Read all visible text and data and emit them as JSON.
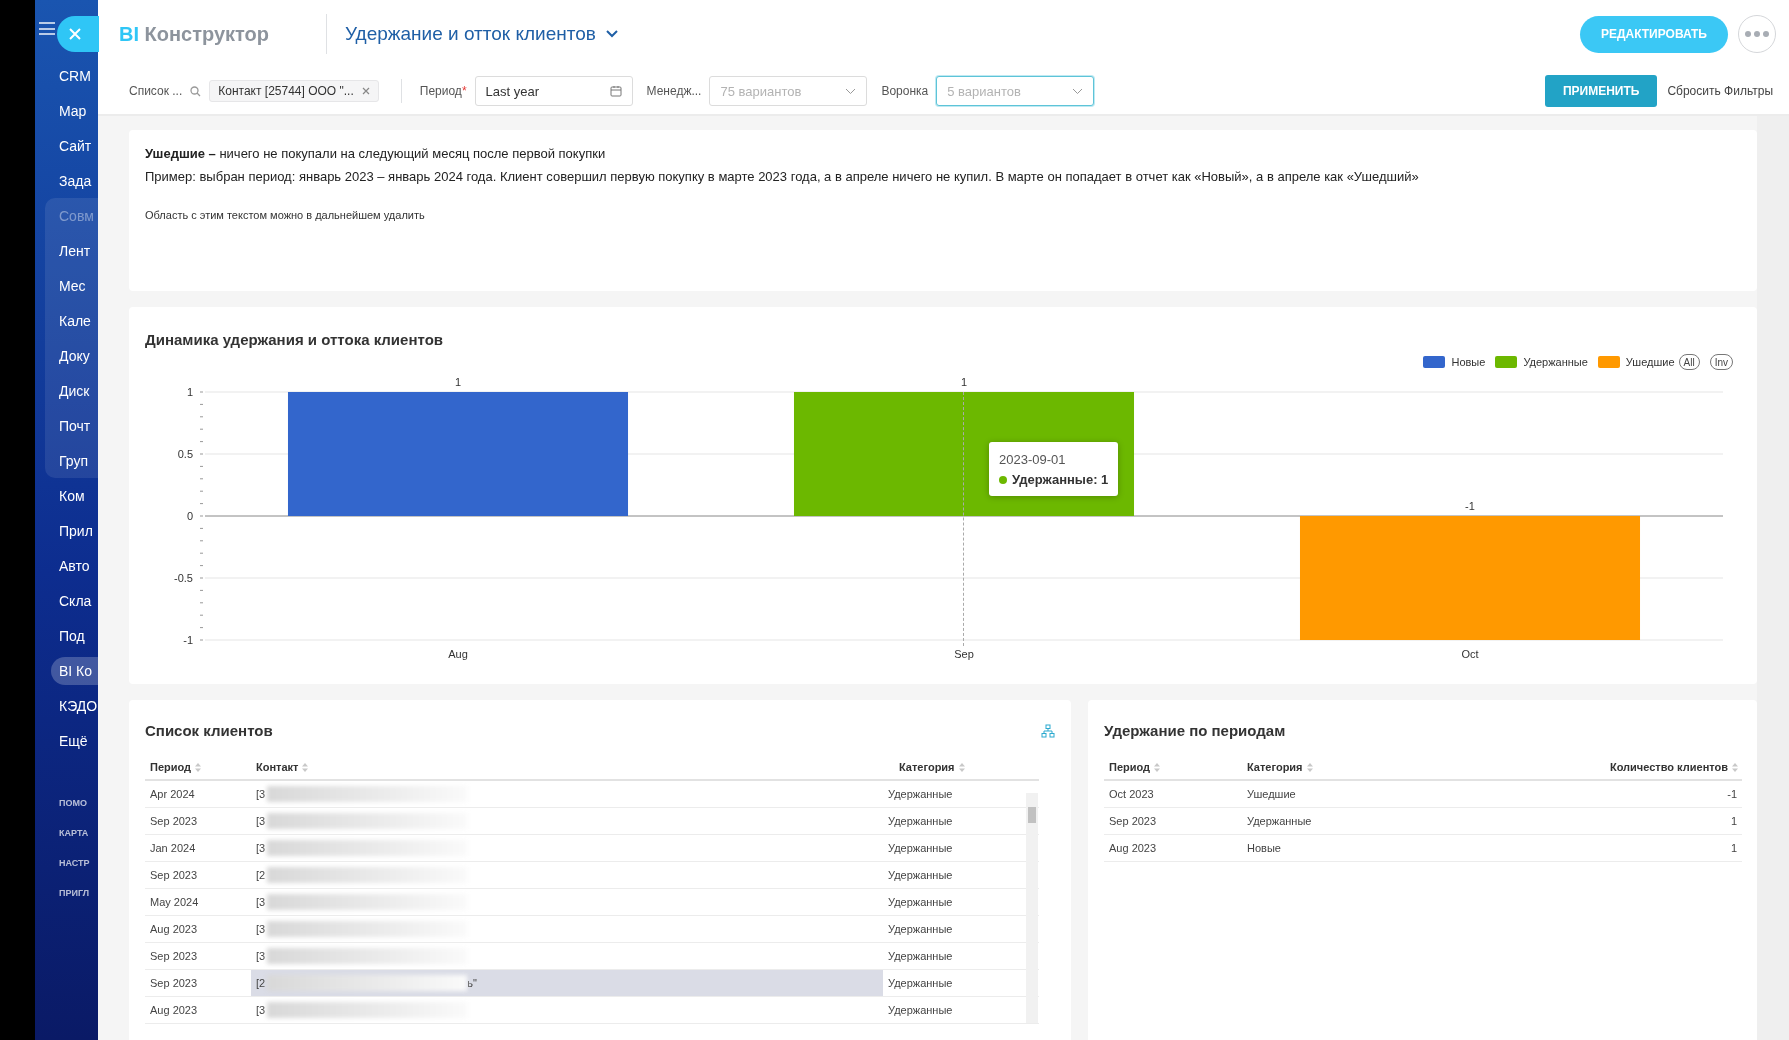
{
  "sidebar": {
    "items": [
      {
        "kind": "item",
        "label": "CRM",
        "selected": false
      },
      {
        "kind": "item",
        "label": "Мар",
        "selected": false
      },
      {
        "kind": "item",
        "label": "Сайт",
        "selected": false
      },
      {
        "kind": "item",
        "label": "Зада",
        "selected": false
      },
      {
        "kind": "group",
        "title": "Совм",
        "children": [
          {
            "kind": "item",
            "label": "Лент",
            "selected": false
          },
          {
            "kind": "item",
            "label": "Мес",
            "selected": false
          },
          {
            "kind": "item",
            "label": "Кале",
            "selected": false
          },
          {
            "kind": "item",
            "label": "Доку",
            "selected": false
          },
          {
            "kind": "item",
            "label": "Диск",
            "selected": false
          },
          {
            "kind": "item",
            "label": "Почт",
            "selected": false
          },
          {
            "kind": "item",
            "label": "Груп",
            "selected": false
          }
        ]
      },
      {
        "kind": "item",
        "label": "Ком",
        "selected": false
      },
      {
        "kind": "item",
        "label": "Прил",
        "selected": false
      },
      {
        "kind": "item",
        "label": "Авто",
        "selected": false
      },
      {
        "kind": "item",
        "label": "Скла",
        "selected": false
      },
      {
        "kind": "item",
        "label": "Под",
        "selected": false
      },
      {
        "kind": "item",
        "label": "BI Ко",
        "selected": true
      },
      {
        "kind": "item",
        "label": "КЭДО",
        "selected": false
      },
      {
        "kind": "item",
        "label": "Ещё",
        "selected": false
      }
    ],
    "footer_links": [
      "ПОМО",
      "КАРТА",
      "НАСТР",
      "ПРИГЛ"
    ]
  },
  "header": {
    "brand_prefix": "BI",
    "brand": "Конструктор",
    "report_title": "Удержание и отток клиентов",
    "edit_button": "РЕДАКТИРОВАТЬ"
  },
  "filters": [
    {
      "kind": "search",
      "label": "Список ...",
      "chip": "Контакт [25744] ООО \"..."
    },
    {
      "kind": "date",
      "label": "Период",
      "required_mark": "*",
      "value": "Last year"
    },
    {
      "kind": "select",
      "label": "Менедж...",
      "placeholder": "75 вариантов",
      "focused": false
    },
    {
      "kind": "select",
      "label": "Воронка",
      "placeholder": "5 вариантов",
      "focused": true
    }
  ],
  "apply_button": "ПРИМЕНИТЬ",
  "reset_link": "Сбросить Фильтры",
  "note": {
    "lines": [
      "**Ушедшие –** ничего не покупали на следующий месяц после первой покупки",
      "Пример: выбран период: январь 2023 – январь 2024 года. Клиент совершил первую покупку в марте 2023 года, а в апреле ничего не купил. В марте он попадает в отчет как «Новый», а в апреле как «Ушедший»"
    ],
    "hint": "Область с этим текстом можно в дальнейшем удалить"
  },
  "chart_card": {
    "title": "Динамика удержания и оттока клиентов",
    "legend_buttons": [
      "All",
      "Inv"
    ],
    "chart_data": {
      "type": "bar",
      "categories": [
        "Aug",
        "Sep",
        "Oct"
      ],
      "series": [
        {
          "name": "Новые",
          "color": "#3366cc",
          "values": [
            1,
            null,
            null
          ]
        },
        {
          "name": "Удержанные",
          "color": "#6cb800",
          "values": [
            null,
            1,
            null
          ]
        },
        {
          "name": "Ушедшие",
          "color": "#ff9900",
          "values": [
            null,
            null,
            -1
          ]
        }
      ],
      "ylim": [
        -1,
        1
      ],
      "yticks": [
        -1,
        -0.5,
        0,
        0.5,
        1
      ],
      "stacked": true,
      "data_labels": true
    },
    "tooltip": {
      "date": "2023-09-01",
      "label": "Удержанные: 1",
      "color": "#6cb800"
    }
  },
  "clients": {
    "title": "Список клиентов",
    "columns": [
      "Период",
      "Контакт",
      "Категория"
    ],
    "rows": [
      {
        "period": "Apr 2024",
        "contact": "[3",
        "category": "Удержанные",
        "selected": false
      },
      {
        "period": "Sep 2023",
        "contact": "[3",
        "category": "Удержанные",
        "selected": false
      },
      {
        "period": "Jan 2024",
        "contact": "[3",
        "category": "Удержанные",
        "selected": false
      },
      {
        "period": "Sep 2023",
        "contact": "[2",
        "category": "Удержанные",
        "selected": false
      },
      {
        "period": "May 2024",
        "contact": "[3",
        "category": "Удержанные",
        "selected": false
      },
      {
        "period": "Aug 2023",
        "contact": "[3",
        "category": "Удержанные",
        "selected": false
      },
      {
        "period": "Sep 2023",
        "contact": "[3",
        "category": "Удержанные",
        "selected": false
      },
      {
        "period": "Sep 2023",
        "contact": "[2",
        "contact_tail": "ь\"",
        "category": "Удержанные",
        "selected": true
      },
      {
        "period": "Aug 2023",
        "contact": "[3",
        "category": "Удержанные",
        "selected": false
      }
    ]
  },
  "retention": {
    "title": "Удержание по периодам",
    "columns": [
      "Период",
      "Категория",
      "Количество клиентов"
    ],
    "rows": [
      {
        "period": "Oct 2023",
        "category": "Ушедшие",
        "count": "-1"
      },
      {
        "period": "Sep 2023",
        "category": "Удержанные",
        "count": "1"
      },
      {
        "period": "Aug 2023",
        "category": "Новые",
        "count": "1"
      }
    ]
  }
}
